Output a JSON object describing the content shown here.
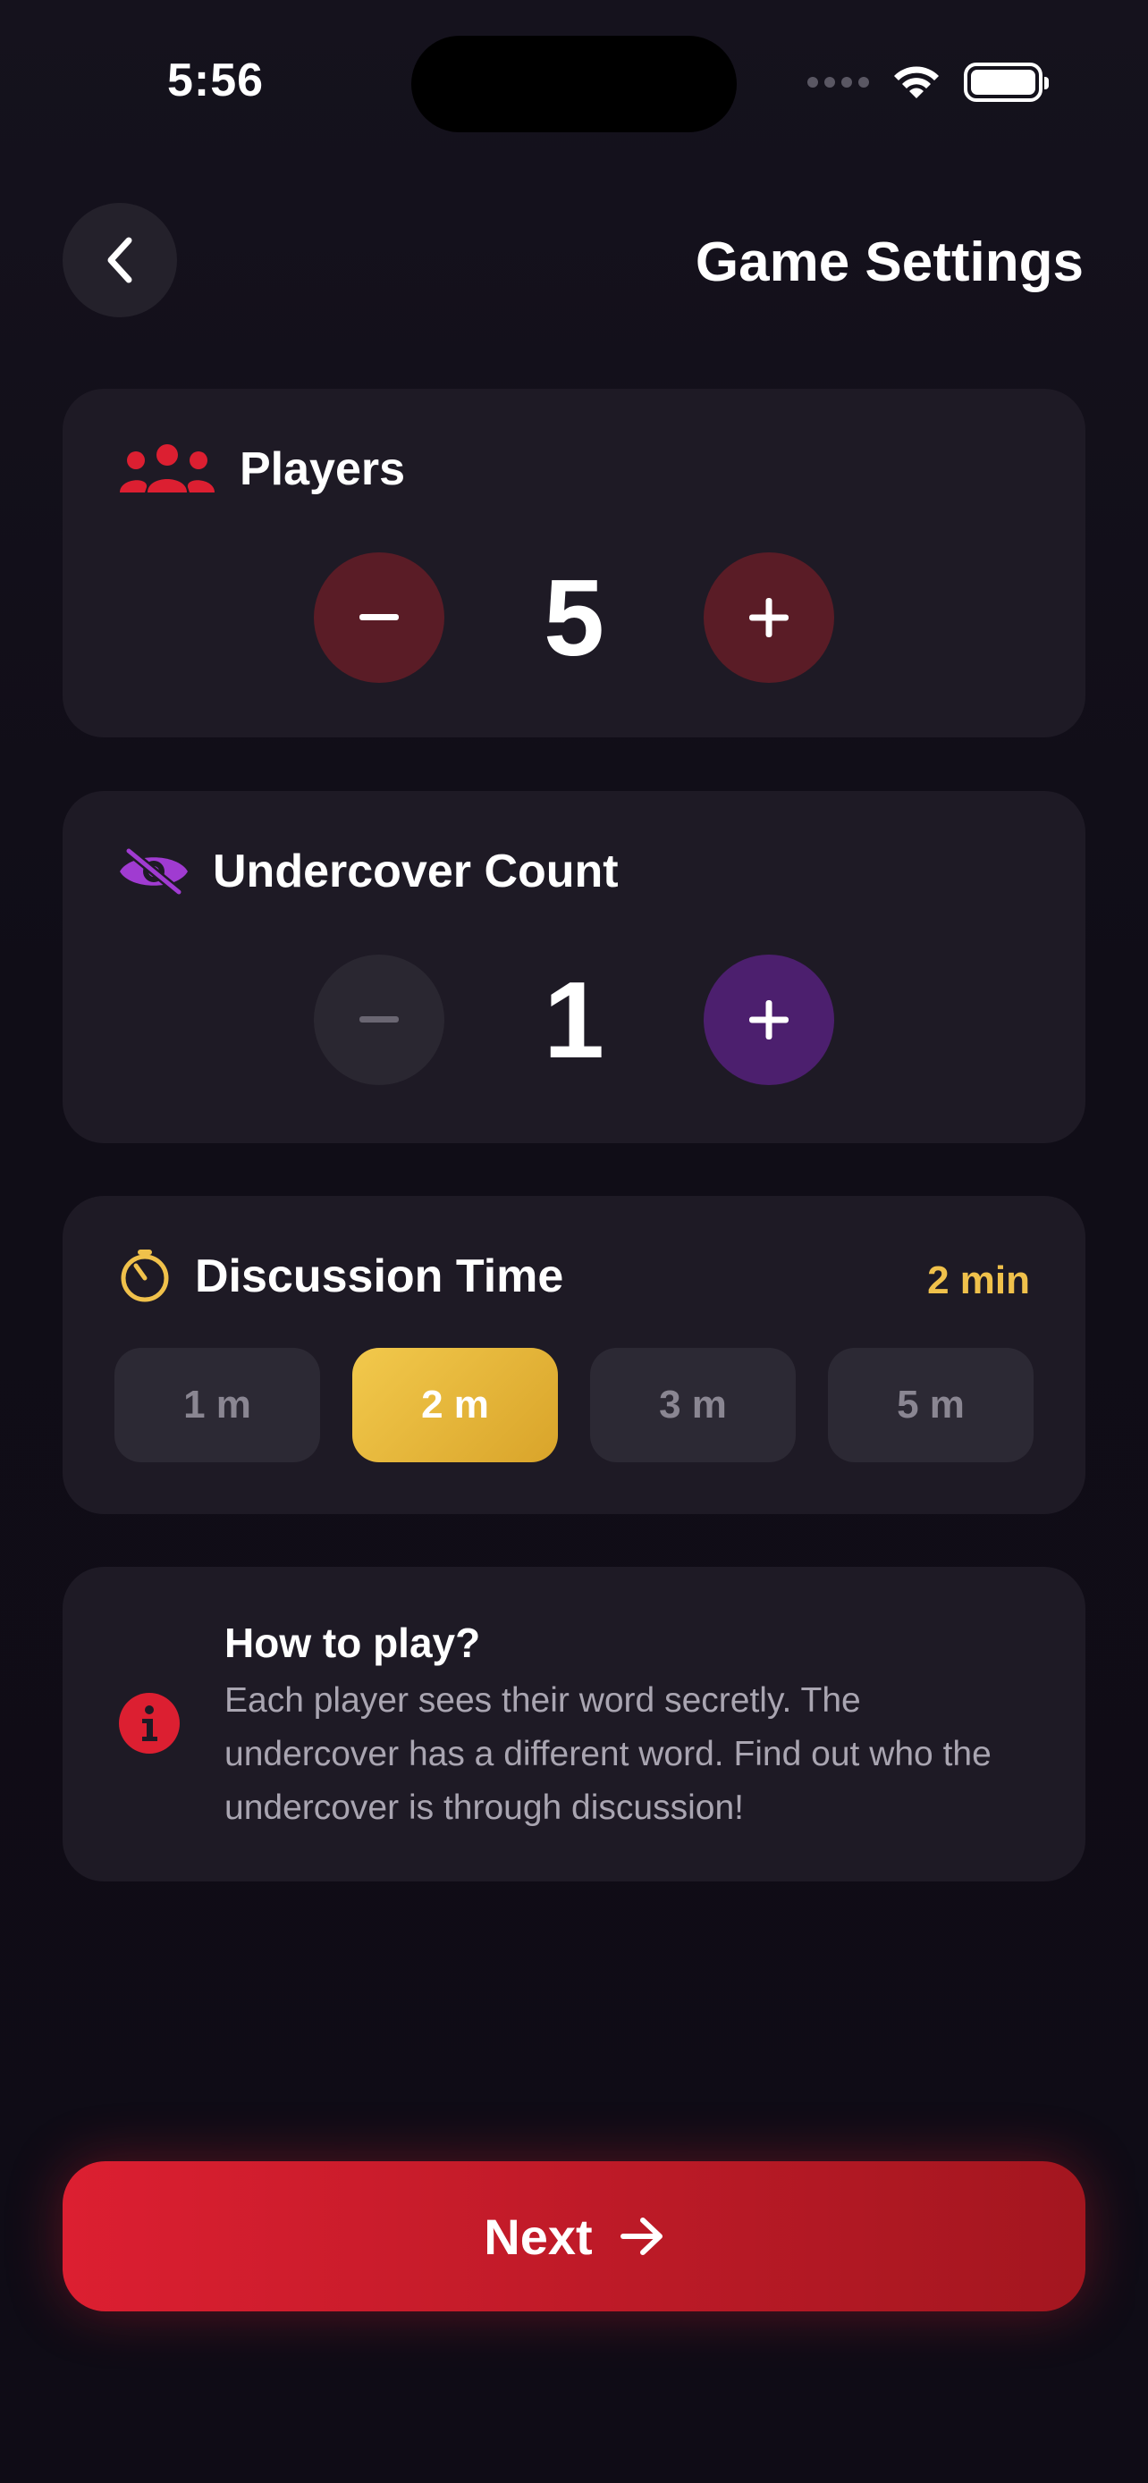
{
  "status_bar": {
    "time": "5:56"
  },
  "header": {
    "title": "Game Settings",
    "back_icon": "chevron-left-icon"
  },
  "players": {
    "label": "Players",
    "value": "5",
    "icon": "users-icon",
    "accent": "#dc1f31"
  },
  "undercover": {
    "label": "Undercover Count",
    "value": "1",
    "icon": "eye-slash-icon",
    "accent": "#a03bd1"
  },
  "discussion_time": {
    "label": "Discussion Time",
    "value": "2 min",
    "icon": "timer-icon",
    "accent": "#f0c14b",
    "options": [
      "1 m",
      "2 m",
      "3 m",
      "5 m"
    ],
    "selected": "2 m"
  },
  "how_to_play": {
    "title": "How to play?",
    "text": "Each player sees their word secretly. The undercover has a different word. Find out who the undercover is through discussion!",
    "icon": "info-icon"
  },
  "next_button": {
    "label": "Next",
    "icon": "arrow-right-icon"
  }
}
